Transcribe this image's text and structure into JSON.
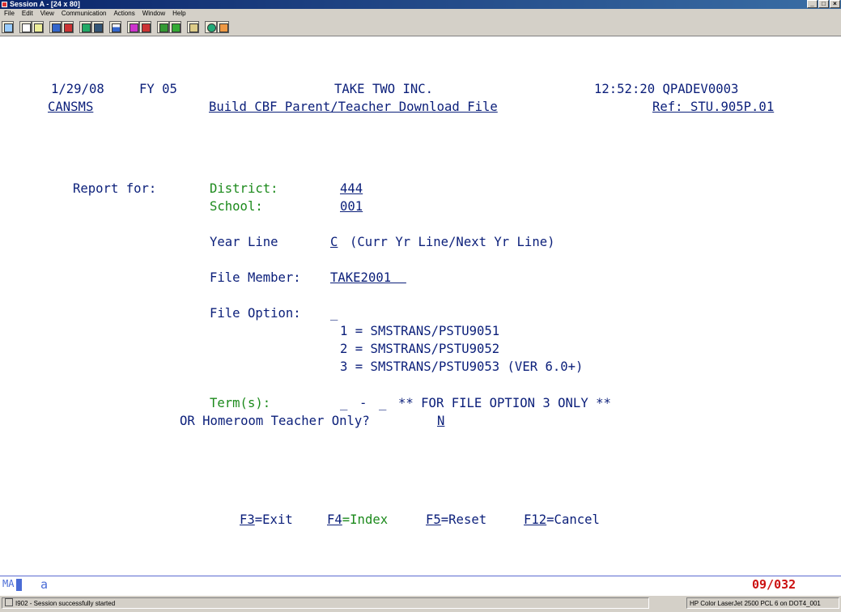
{
  "window": {
    "title": "Session A - [24 x 80]",
    "buttons": [
      "_",
      "□",
      "×"
    ]
  },
  "menu": [
    "File",
    "Edit",
    "View",
    "Communication",
    "Actions",
    "Window",
    "Help"
  ],
  "screen": {
    "date": "1/29/08",
    "fy": "FY 05",
    "company": "TAKE TWO INC.",
    "time_system": "12:52:20 QPADEV0003",
    "program": "CANSMS",
    "screen_title": "Build CBF Parent/Teacher Download File",
    "ref": "Ref: STU.905P.01",
    "report_for_label": "Report for:",
    "district_label": "District:",
    "district_value": "444",
    "school_label": "School:",
    "school_value": "001",
    "year_line_label": "Year Line",
    "year_line_value": "C",
    "year_line_hint": "(Curr Yr Line/Next Yr Line)",
    "file_member_label": "File Member:",
    "file_member_value": "TAKE2001  ",
    "file_option_label": "File Option:",
    "file_option_value": "_",
    "option_1": "1 = SMSTRANS/PSTU9051",
    "option_2": "2 = SMSTRANS/PSTU9052",
    "option_3": "3 = SMSTRANS/PSTU9053 (VER 6.0+)",
    "terms_label": "Term(s):",
    "term_from": "_",
    "term_sep": "-",
    "term_to": "_",
    "terms_note": "** FOR FILE OPTION 3 ONLY **",
    "homeroom_label": "OR Homeroom Teacher Only?",
    "homeroom_value": "N",
    "fkeys": {
      "f3_key": "F3",
      "f3_text": "=Exit",
      "f4_key": "F4",
      "f4_text": "=Index",
      "f5_key": "F5",
      "f5_text": "=Reset",
      "f12_key": "F12",
      "f12_text": "=Cancel"
    }
  },
  "oia": {
    "indicator": "MA",
    "mode": "a",
    "cursor_position": "09/032"
  },
  "status": {
    "message": "I902 - Session successfully started",
    "printer": "HP Color LaserJet 2500 PCL 6 on DOT4_001"
  },
  "colors": {
    "field_text": "#0b1f7a",
    "label_green": "#1c8a1c",
    "position_red": "#cc1111",
    "oia_blue": "#4a6cd6"
  }
}
